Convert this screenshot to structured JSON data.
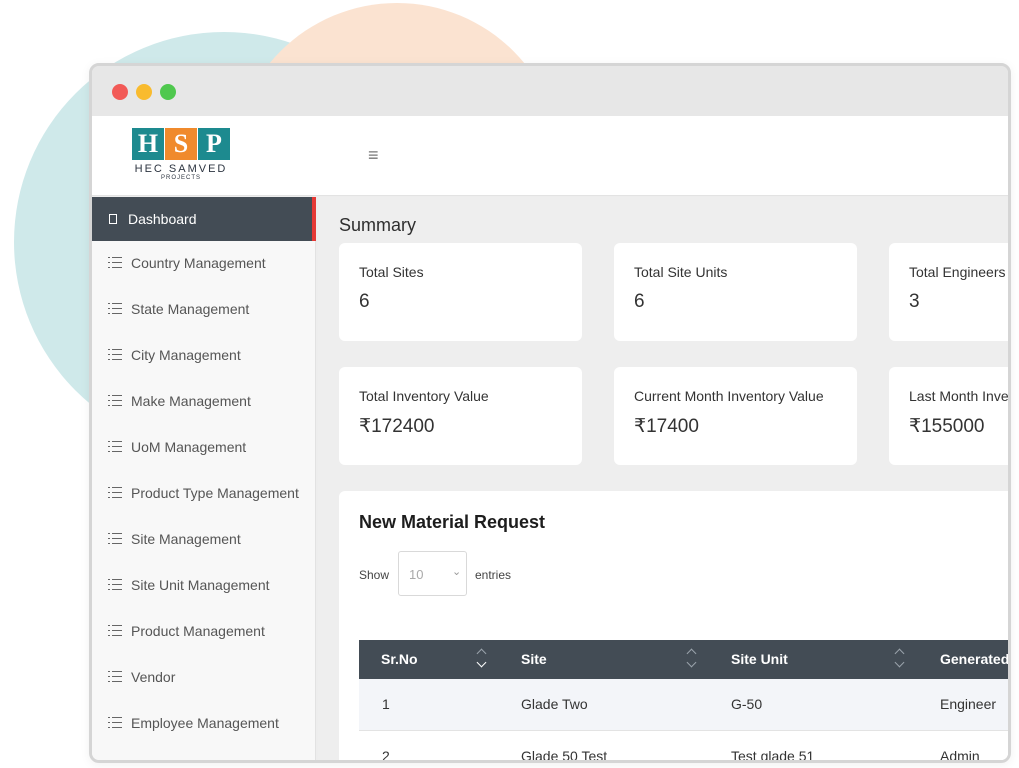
{
  "brand": {
    "letters": [
      "H",
      "S",
      "P"
    ],
    "name": "HEC SAMVED",
    "tagline": "PROJECTS"
  },
  "header": {
    "menu_icon": "hamburger-icon",
    "menu_glyph": "≡"
  },
  "sidebar": {
    "active": {
      "label": "Dashboard",
      "icon": "square-icon"
    },
    "items": [
      {
        "label": "Country Management",
        "icon": "list-icon"
      },
      {
        "label": "State Management",
        "icon": "list-icon"
      },
      {
        "label": "City Management",
        "icon": "list-icon"
      },
      {
        "label": "Make Management",
        "icon": "list-icon"
      },
      {
        "label": "UoM Management",
        "icon": "list-icon"
      },
      {
        "label": "Product Type Management",
        "icon": "list-icon"
      },
      {
        "label": "Site Management",
        "icon": "list-icon"
      },
      {
        "label": "Site Unit Management",
        "icon": "list-icon"
      },
      {
        "label": "Product Management",
        "icon": "list-icon"
      },
      {
        "label": "Vendor",
        "icon": "list-icon"
      },
      {
        "label": "Employee Management",
        "icon": "list-icon"
      }
    ]
  },
  "summary": {
    "title": "Summary",
    "cards": [
      {
        "label": "Total Sites",
        "value": "6"
      },
      {
        "label": "Total Site Units",
        "value": "6"
      },
      {
        "label": "Total Engineers",
        "value": "3"
      },
      {
        "label": "Total Inventory Value",
        "value": "₹172400"
      },
      {
        "label": "Current Month Inventory Value",
        "value": "₹17400"
      },
      {
        "label": "Last Month Inve",
        "value": "₹155000"
      }
    ]
  },
  "requests": {
    "title": "New Material Request",
    "show_label": "Show",
    "page_size": "10",
    "entries_label": "entries",
    "columns": [
      "Sr.No",
      "Site",
      "Site Unit",
      "Generated"
    ],
    "rows": [
      [
        "1",
        "Glade Two",
        "G-50",
        "Engineer"
      ],
      [
        "2",
        "Glade 50 Test",
        "Test glade 51",
        "Admin"
      ]
    ]
  },
  "colors": {
    "accent_red": "#e53935",
    "sidebar_active_bg": "#434c55",
    "brand_teal": "#1d8a8f",
    "brand_orange": "#f08a2c"
  }
}
